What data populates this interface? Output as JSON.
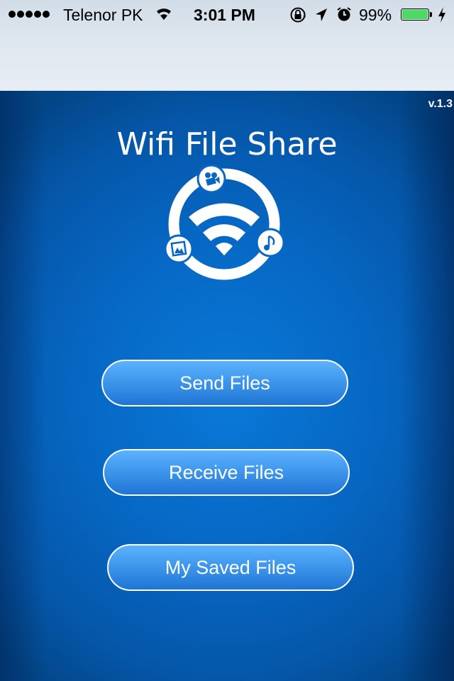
{
  "status_bar": {
    "signal_bars": 5,
    "carrier": "Telenor PK",
    "time": "3:01 PM",
    "battery_percent_label": "99%",
    "battery_level": 0.99,
    "icons": [
      "signal-dots-icon",
      "wifi-icon",
      "rotation-lock-icon",
      "location-arrow-icon",
      "alarm-clock-icon",
      "battery-icon",
      "charging-bolt-icon"
    ],
    "battery_color": "#4cd964"
  },
  "app": {
    "version": "v.1.3",
    "title": "Wifi File Share",
    "logo_icons": [
      "wifi-icon",
      "video-camera-icon",
      "music-note-icon",
      "image-icon"
    ],
    "background_color": "#0668c4"
  },
  "buttons": {
    "send": "Send Files",
    "receive": "Receive Files",
    "saved": "My Saved Files"
  }
}
